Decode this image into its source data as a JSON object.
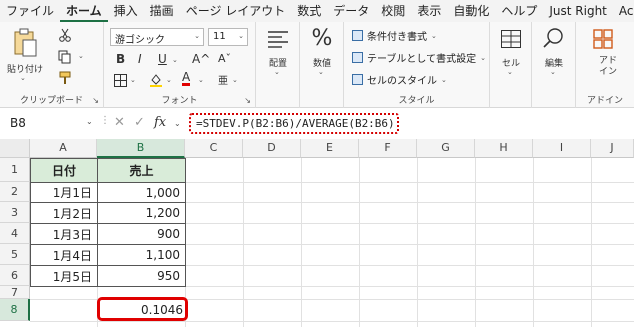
{
  "menu": {
    "tabs": [
      "ファイル",
      "ホーム",
      "挿入",
      "描画",
      "ページ レイアウト",
      "数式",
      "データ",
      "校閲",
      "表示",
      "自動化",
      "ヘルプ",
      "Just Right",
      "Acrobat"
    ],
    "active": "ホーム"
  },
  "ribbon": {
    "clipboard": {
      "paste": "貼り付け",
      "group": "クリップボード"
    },
    "font": {
      "name": "游ゴシック",
      "size": "11",
      "group": "フォント",
      "bold": "B",
      "italic": "I",
      "underline": "U",
      "grow": "A^",
      "shrink": "Aˇ",
      "font_color": "A",
      "phonetic": "亜"
    },
    "alignment": {
      "label": "配置"
    },
    "number": {
      "label": "数値",
      "symbol": "%"
    },
    "styles": {
      "conditional": "条件付き書式",
      "table": "テーブルとして書式設定",
      "cell_styles": "セルのスタイル",
      "group": "スタイル"
    },
    "cells": {
      "label": "セル"
    },
    "editing": {
      "label": "編集"
    },
    "addins": {
      "label": "アド\nイン",
      "group": "アドイン"
    }
  },
  "formula_bar": {
    "name_box": "B8",
    "cancel": "✕",
    "enter": "✓",
    "fx": "fx",
    "formula": "=STDEV.P(B2:B6)/AVERAGE(B2:B6)"
  },
  "grid": {
    "columns": [
      "A",
      "B",
      "C",
      "D",
      "E",
      "F",
      "G",
      "H",
      "I",
      "J"
    ],
    "rows": [
      "1",
      "2",
      "3",
      "4",
      "5",
      "6",
      "7",
      "8"
    ],
    "selected_column": "B",
    "selected_row": "8"
  },
  "table": {
    "headers": [
      "日付",
      "売上"
    ],
    "rows": [
      [
        "1月1日",
        "1,000"
      ],
      [
        "1月2日",
        "1,200"
      ],
      [
        "1月3日",
        "900"
      ],
      [
        "1月4日",
        "1,100"
      ],
      [
        "1月5日",
        "950"
      ]
    ],
    "result": "0.1046"
  },
  "colors": {
    "accent": "#1e7145",
    "highlight": "#e00000",
    "header_fill": "#d9ecd9"
  }
}
